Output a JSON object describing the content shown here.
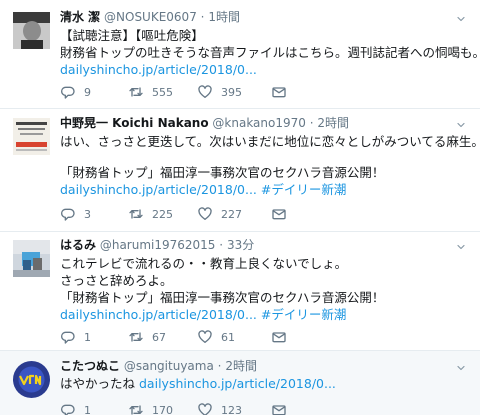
{
  "tweets": [
    {
      "name": "清水 潔",
      "handle": "@NOSUKE0607",
      "dot": "·",
      "time": "1時間",
      "lines": [
        "【試聴注意】【嘔吐危険】",
        "財務省トップの吐きそうな音声ファイルはこちら。週刊誌記者への恫喝も。"
      ],
      "link": "dailyshincho.jp/article/2018/0...",
      "replies": "9",
      "retweets": "555",
      "likes": "395"
    },
    {
      "name": "中野晃一  Koichi Nakano",
      "handle": "@knakano1970",
      "dot": "·",
      "time": "2時間",
      "lines": [
        "はい、さっさと更迭して。次はいまだに地位に恋々としがみついてる麻生。",
        "「財務省トップ」福田淳一事務次官のセクハラ音源公開！"
      ],
      "link": "dailyshincho.jp/article/2018/0...",
      "hashtag": "#デイリー新潮",
      "replies": "3",
      "retweets": "225",
      "likes": "227"
    },
    {
      "name": "はるみ",
      "handle": "@harumi19762015",
      "dot": "·",
      "time": "33分",
      "lines": [
        "これテレビで流れるの・・教育上良くないでしょ。",
        "さっさと辞めろよ。",
        "「財務省トップ」福田淳一事務次官のセクハラ音源公開！"
      ],
      "link": "dailyshincho.jp/article/2018/0...",
      "hashtag": "#デイリー新潮",
      "replies": "1",
      "retweets": "67",
      "likes": "61"
    },
    {
      "name": "こたつぬこ",
      "handle": "@sangituyama",
      "dot": "·",
      "time": "2時間",
      "lines": [
        "はやかったね"
      ],
      "link": "dailyshincho.jp/article/2018/0...",
      "replies": "1",
      "retweets": "170",
      "likes": "123"
    }
  ],
  "icons": {
    "reply": "reply-icon",
    "retweet": "retweet-icon",
    "like": "heart-icon",
    "dm": "envelope-icon",
    "menu": "chevron-down-icon"
  },
  "colors": {
    "link": "#1b95e0",
    "secondary": "#657786",
    "border": "#e6ecf0",
    "selected_bg": "#f5f8fa"
  }
}
